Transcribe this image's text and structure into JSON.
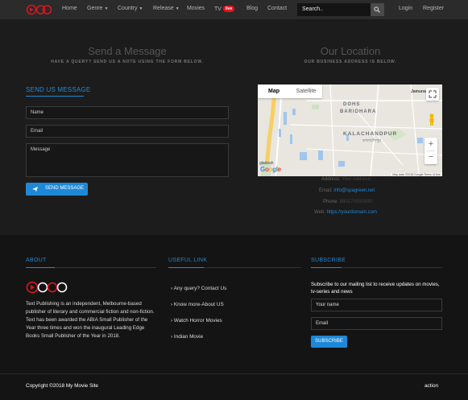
{
  "nav": {
    "items": [
      {
        "label": "Home"
      },
      {
        "label": "Genre"
      },
      {
        "label": "Country"
      },
      {
        "label": "Release"
      },
      {
        "label": "Movies"
      },
      {
        "label": "TV"
      },
      {
        "label": "Blog"
      },
      {
        "label": "Contact"
      }
    ],
    "live_badge": "live",
    "search_placeholder": "Search..",
    "login": "Login",
    "register": "Register"
  },
  "contact": {
    "send_title": "Send a Message",
    "send_subtitle": "HAVE A QUERY? SEND US A NOTE USING THE FORM BELOW.",
    "location_title": "Our Location",
    "location_subtitle": "OUR BUSINESS ADDRESS IS BELOW.",
    "form_heading": "SEND US MESSAGE",
    "name_placeholder": "Name",
    "email_placeholder": "Email",
    "message_placeholder": "Message",
    "send_button": "SEND MESSAGE"
  },
  "map": {
    "tab_map": "Map",
    "tab_satellite": "Satellite",
    "label_area1": "DOHS",
    "label_area2": "BARIDHARA",
    "label_area3": "KALACHANDPUR",
    "label_area3_local": "কালাচাঁদপুর",
    "label_road": "Jamuna F",
    "label_corner": "gladesh",
    "footer": "Map data ©2018 Google   Terms of Use",
    "google": "Google"
  },
  "info": {
    "address_label": "Address:",
    "address_value": "Your Address",
    "email_label": "Email:",
    "email_value": "info@spagreen.net",
    "phone_label": "Phone:",
    "phone_value": "880170000000",
    "web_label": "Web:",
    "web_value": "https://yourdomain.com"
  },
  "footer": {
    "about_heading": "ABOUT",
    "about_text": "Text Publishing is an independent, Melbourne-based publisher of literary and commercial fiction and non-fiction. Text has been awarded the ABIA Small Publisher of the Year three times and won the inaugural Leading Edge Books Small Publisher of the Year in 2018.",
    "useful_heading": "USEFUL LINK",
    "links": [
      "Any query? Contact Us",
      "Know more-About US",
      "Watch Horror Movies",
      "Indian Movie"
    ],
    "subscribe_heading": "SUBSCRIBE",
    "subscribe_text": "Subscribe to our mailing list to receive updates on movies, tv-series and news",
    "your_name_placeholder": "Your name",
    "email_placeholder": "Email",
    "subscribe_button": "SUBSCRIBE",
    "copyright": "Copyright ©2018 My Movie Site",
    "action": "action"
  },
  "colors": {
    "accent": "#1e88d8",
    "live": "#e0141e",
    "logo": "#e0141e"
  }
}
